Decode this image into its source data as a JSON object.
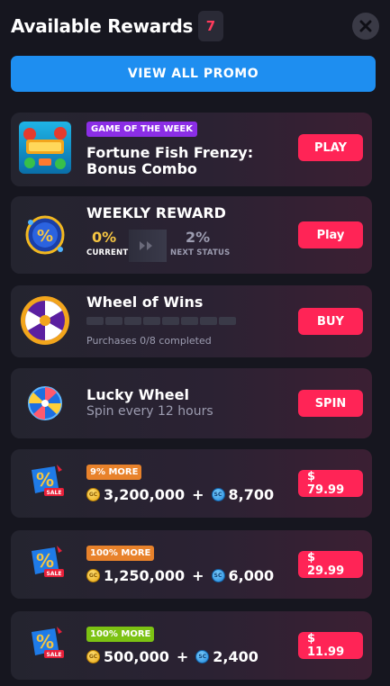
{
  "header": {
    "title": "Available Rewards",
    "count": "7"
  },
  "promo": {
    "label": "VIEW ALL PROMO"
  },
  "game_of_week": {
    "badge": "GAME OF THE WEEK",
    "title_line1": "Fortune Fish Frenzy:",
    "title_line2": "Bonus Combo",
    "action": "PLAY"
  },
  "weekly": {
    "title": "WEEKLY REWARD",
    "current_value": "0%",
    "current_label": "CURRENT",
    "next_value": "2%",
    "next_label": "NEXT STATUS",
    "action": "Play"
  },
  "wheel_of_wins": {
    "title": "Wheel of Wins",
    "progress": 0,
    "segments": 8,
    "progress_text": "Purchases 0/8 completed",
    "action": "BUY"
  },
  "lucky_wheel": {
    "title": "Lucky Wheel",
    "subtitle": "Spin every 12 hours",
    "action": "SPIN"
  },
  "offers": [
    {
      "badge": "9% MORE",
      "badge_color": "#e8822b",
      "gold": "3,200,000",
      "plus": "+",
      "sc": "8,700",
      "price": "$ 79.99"
    },
    {
      "badge": "100% MORE",
      "badge_color": "#e8822b",
      "gold": "1,250,000",
      "plus": "+",
      "sc": "6,000",
      "price": "$ 29.99"
    },
    {
      "badge": "100% MORE",
      "badge_color": "#7cc213",
      "gold": "500,000",
      "plus": "+",
      "sc": "2,400",
      "price": "$ 11.99"
    }
  ],
  "colors": {
    "accent": "#ff2456",
    "promo": "#1e8ef0",
    "badge_purple": "#8b2ee6",
    "gold": "#f5c542"
  }
}
